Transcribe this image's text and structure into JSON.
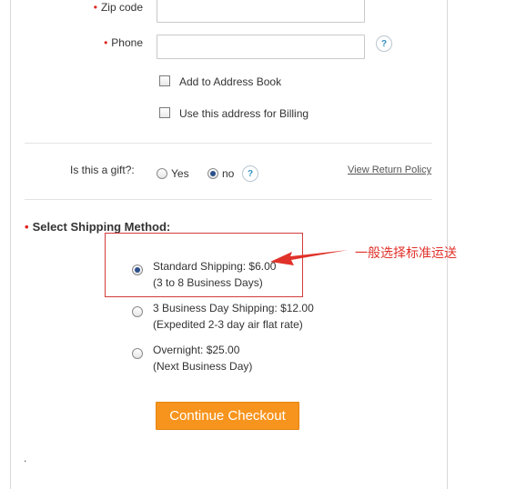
{
  "address_form": {
    "zip": {
      "label": "Zip code",
      "required_mark": "•",
      "value": ""
    },
    "phone": {
      "label": "Phone",
      "required_mark": "•",
      "value": "",
      "help": "?"
    },
    "add_to_address_book": {
      "label": "Add to Address Book",
      "checked": false
    },
    "use_for_billing": {
      "label": "Use this address for Billing",
      "checked": false
    }
  },
  "gift": {
    "label": "Is this a gift?:",
    "yes": "Yes",
    "no": "no",
    "selected": "no",
    "help": "?",
    "return_policy_link": "View Return Policy"
  },
  "shipping": {
    "required_mark": "•",
    "title": "Select Shipping Method:",
    "options": [
      {
        "line1": "Standard Shipping: $6.00",
        "line2": "(3 to 8 Business Days)",
        "selected": true
      },
      {
        "line1": "3 Business Day Shipping: $12.00",
        "line2": "(Expedited 2-3 day air flat rate)",
        "selected": false
      },
      {
        "line1": "Overnight: $25.00",
        "line2": "(Next Business Day)",
        "selected": false
      }
    ]
  },
  "annotation": {
    "text": "一般选择标准运送",
    "color": "#e0322a"
  },
  "continue_button": "Continue Checkout",
  "footer_mark": ".",
  "colors": {
    "accent": "#f7941d",
    "required": "#e2251f",
    "highlight": "#d43b3b"
  }
}
